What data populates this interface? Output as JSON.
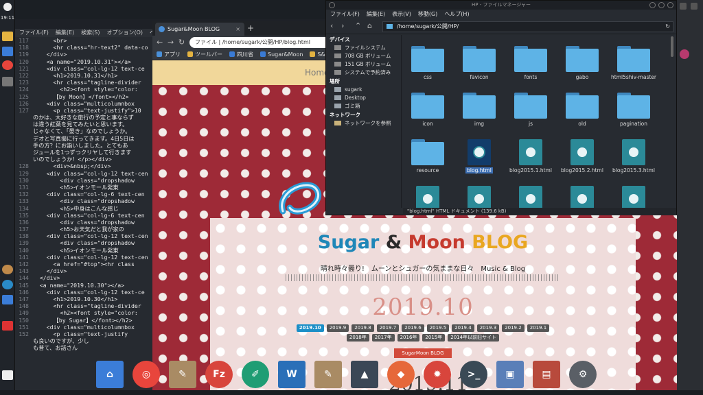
{
  "panel": {
    "clock": "19:11"
  },
  "editor": {
    "menu": [
      "ファイル(F)",
      "編集(E)",
      "検索(S)",
      "オプション(O)",
      "ヘル"
    ],
    "lines": [
      {
        "n": "117",
        "t": "      <br>"
      },
      {
        "n": "118",
        "t": "      <hr class=\"hr-text2\" data-co"
      },
      {
        "n": "119",
        "t": "    </div>"
      },
      {
        "n": "120",
        "t": "    <a name=\"2019.10.31\"></a>"
      },
      {
        "n": "121",
        "t": "    <div class=\"col-lg-12 text-ce"
      },
      {
        "n": "122",
        "t": "      <h1>2019.10.31</h1>"
      },
      {
        "n": "123",
        "t": "      <hr class=\"tagline-divider"
      },
      {
        "n": "124",
        "t": "        <h2><font style=\"color:"
      },
      {
        "n": "125",
        "t": "      【by Moon】</font></h2>"
      },
      {
        "n": "126",
        "t": "    <div class=\"multicolumnbox"
      },
      {
        "n": "127",
        "t": "      <p class=\"text-justify\">10"
      },
      {
        "n": "",
        "t": "のかは、大好きな旅行の予定と事ならず"
      },
      {
        "n": "",
        "t": "は違う紅葉を見てみたいと思います。"
      },
      {
        "n": "",
        "t": "じゃなくて、「晏き」なのでしょうか。"
      },
      {
        "n": "",
        "t": "デオと写真撮に行ってきます。4日5日は"
      },
      {
        "n": "",
        "t": "手の方？にお詣いしました。とてもあ"
      },
      {
        "n": "",
        "t": "ジュールを1つずつクリヤして行きます"
      },
      {
        "n": "",
        "t": "いのでしょうか！</p></div>"
      },
      {
        "n": "128",
        "t": "      <div>&nbsp;</div>"
      },
      {
        "n": "129",
        "t": "    <div class=\"col-lg-12 text-cen"
      },
      {
        "n": "130",
        "t": "        <div class=\"dropshadow"
      },
      {
        "n": "131",
        "t": "        <h5>イオンモール発東"
      },
      {
        "n": "132",
        "t": "    <div class=\"col-lg-6 text-cen"
      },
      {
        "n": "133",
        "t": "        <div class=\"dropshadow"
      },
      {
        "n": "134",
        "t": "        <h5>中身はこんな感じ"
      },
      {
        "n": "135",
        "t": "    <div class=\"col-lg-6 text-cen"
      },
      {
        "n": "136",
        "t": "        <div class=\"dropshadow"
      },
      {
        "n": "137",
        "t": "        <h5>お天気だと我が家の"
      },
      {
        "n": "138",
        "t": "    <div class=\"col-lg-12 text-cen"
      },
      {
        "n": "139",
        "t": "        <div class=\"dropshadow"
      },
      {
        "n": "140",
        "t": "        <h5>イオンモール発東"
      },
      {
        "n": "141",
        "t": "    <div class=\"col-lg-12 text-cen"
      },
      {
        "n": "142",
        "t": "      <a href=\"#top\"><hr class"
      },
      {
        "n": "143",
        "t": "    </div>"
      },
      {
        "n": "144",
        "t": "  </div>"
      },
      {
        "n": "145",
        "t": "  <a name=\"2019.10.30\"></a>"
      },
      {
        "n": "146",
        "t": "    <div class=\"col-lg-12 text-ce"
      },
      {
        "n": "147",
        "t": "      <h1>2019.10.30</h1>"
      },
      {
        "n": "148",
        "t": "      <hr class=\"tagline-divider"
      },
      {
        "n": "149",
        "t": "        <h2><font style=\"color:"
      },
      {
        "n": "150",
        "t": "      【by Sugar】</font></h2>"
      },
      {
        "n": "151",
        "t": "    <div class=\"multicolumnbox"
      },
      {
        "n": "152",
        "t": "      <p class=\"text-justify"
      },
      {
        "n": "",
        "t": "も良いのですが、少し"
      },
      {
        "n": "",
        "t": "も普て、お話さん"
      }
    ]
  },
  "browser": {
    "tab_title": "Sugar&Moon BLOG",
    "tab_close": "×",
    "new_tab": "+",
    "url": "ファイル  |  /home/sugark/公開/HP/blog.html",
    "bookmarks": [
      {
        "label": "アプリ",
        "color": "#4a90d9"
      },
      {
        "label": "ツールバー",
        "color": "#e3b341"
      },
      {
        "label": "四川省",
        "color": "#3a7bd5"
      },
      {
        "label": "Sugar&Moon",
        "color": "#3a7bd5"
      },
      {
        "label": "S&",
        "color": "#e3b341"
      }
    ],
    "page": {
      "nav_home": "Home",
      "title_sugar": "Sugar",
      "title_amp": " & ",
      "title_moon": "Moon",
      "title_blog": " BLOG",
      "tagline": "晴れ時々曇り!　ムーンとシュガーの気ままな日々　Music & Blog",
      "month": "2019.10",
      "row1": [
        "2019.10",
        "2019.9",
        "2019.8",
        "2019.7",
        "2019.6",
        "2019.5",
        "2019.4",
        "2019.3",
        "2019.2",
        "2019.1"
      ],
      "row2": [
        "2018年",
        "2017年",
        "2016年",
        "2015年",
        "2014年以前旧サイト"
      ],
      "section_button": "SugarMoon BLOG",
      "bottom_date": "2019.11"
    }
  },
  "filemanager": {
    "title": "HP - ファイルマネージャー",
    "menu": [
      "ファイル(F)",
      "編集(E)",
      "表示(V)",
      "移動(G)",
      "ヘルプ(H)"
    ],
    "path": "/home/sugark/公開/HP/",
    "sections": {
      "devices": "デバイス",
      "places": "場所",
      "network": "ネットワーク"
    },
    "devices": [
      "ファイルシステム",
      "708 GB ボリューム",
      "151 GB ボリューム",
      "システムで予約済み"
    ],
    "places": [
      "sugark",
      "Desktop",
      "ゴミ箱"
    ],
    "network": [
      "ネットワークを参照"
    ],
    "items": [
      {
        "name": "css",
        "type": "folder"
      },
      {
        "name": "favicon",
        "type": "folder"
      },
      {
        "name": "fonts",
        "type": "folder"
      },
      {
        "name": "gabo",
        "type": "folder"
      },
      {
        "name": "html5shiv-master",
        "type": "folder"
      },
      {
        "name": "icon",
        "type": "folder"
      },
      {
        "name": "img",
        "type": "folder"
      },
      {
        "name": "js",
        "type": "folder"
      },
      {
        "name": "old",
        "type": "folder"
      },
      {
        "name": "pagination",
        "type": "folder"
      },
      {
        "name": "resource",
        "type": "folder"
      },
      {
        "name": "blog.html",
        "type": "html",
        "selected": true
      },
      {
        "name": "blog2015.1.html",
        "type": "html"
      },
      {
        "name": "blog2015.2.html",
        "type": "html"
      },
      {
        "name": "blog2015.3.html",
        "type": "html"
      },
      {
        "name": "",
        "type": "html"
      },
      {
        "name": "",
        "type": "html"
      },
      {
        "name": "",
        "type": "html"
      },
      {
        "name": "",
        "type": "html"
      },
      {
        "name": "",
        "type": "html"
      }
    ],
    "status": "\"blog.html\" HTML ドキュメント (139.6 kB)"
  },
  "dock": [
    {
      "name": "home-folder-icon",
      "color": "#3b7dd8",
      "glyph": "⌂",
      "shape": "sq"
    },
    {
      "name": "chrome-icon",
      "color": "#e8453c",
      "glyph": "◎",
      "shape": "circle"
    },
    {
      "name": "text-editor-icon",
      "color": "#a98b64",
      "glyph": "✎",
      "shape": "sq"
    },
    {
      "name": "filezilla-icon",
      "color": "#d8453c",
      "glyph": "Fz",
      "shape": "circle"
    },
    {
      "name": "gimp-icon",
      "color": "#1f9d74",
      "glyph": "✐",
      "shape": "circle"
    },
    {
      "name": "writer-icon",
      "color": "#2a6fb8",
      "glyph": "W",
      "shape": "sq"
    },
    {
      "name": "notes-icon",
      "color": "#a98b64",
      "glyph": "✎",
      "shape": "sq"
    },
    {
      "name": "mountain-app-icon",
      "color": "#3b4756",
      "glyph": "▲",
      "shape": "sq"
    },
    {
      "name": "firefox-icon",
      "color": "#e6683a",
      "glyph": "◆",
      "shape": "circle"
    },
    {
      "name": "burner-icon",
      "color": "#d8453c",
      "glyph": "✹",
      "shape": "circle"
    },
    {
      "name": "terminal-icon",
      "color": "#3a4a56",
      "glyph": ">_",
      "shape": "circle"
    },
    {
      "name": "screenshot-icon",
      "color": "#5a7fb8",
      "glyph": "▣",
      "shape": "sq"
    },
    {
      "name": "archive-icon",
      "color": "#b84a3c",
      "glyph": "▤",
      "shape": "sq"
    },
    {
      "name": "settings-icon",
      "color": "#5a5f66",
      "glyph": "⚙",
      "shape": "circle"
    }
  ]
}
